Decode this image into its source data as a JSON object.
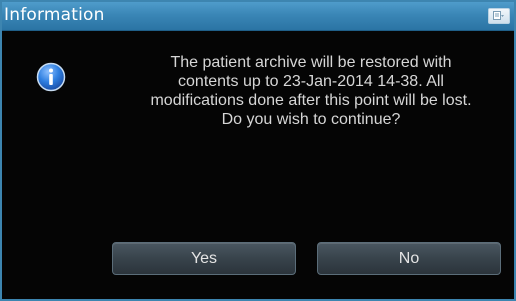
{
  "dialog": {
    "title": "Information",
    "title_button_icon": "window-menu-icon",
    "icon": "info-icon",
    "message": "The patient archive will be restored with\ncontents up to 23-Jan-2014 14-38. All\nmodifications done after this point will be lost.\nDo you wish to continue?",
    "buttons": {
      "yes_label": "Yes",
      "no_label": "No"
    }
  },
  "colors": {
    "titlebar": "#3a86b6",
    "border": "#3d85b0",
    "background": "#050505",
    "text": "#d6d6d6",
    "icon": "#2f7fe0"
  }
}
